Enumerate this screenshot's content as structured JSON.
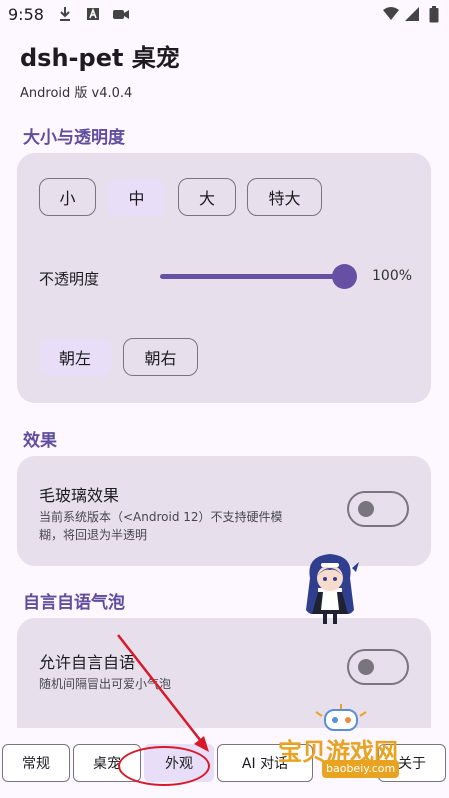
{
  "status_bar": {
    "time": "9:58",
    "icons": [
      "download-icon",
      "a-icon",
      "camera-icon",
      "wifi-icon",
      "signal-icon",
      "battery-icon"
    ]
  },
  "app": {
    "title": "dsh-pet 桌宠",
    "version": "Android 版 v4.0.4"
  },
  "size_section": {
    "title": "大小与透明度",
    "size_options": [
      "小",
      "中",
      "大",
      "特大"
    ],
    "selected_size": "中",
    "opacity_label": "不透明度",
    "opacity_value": "100%",
    "opacity_fraction": 1.0,
    "direction_options": [
      "朝左",
      "朝右"
    ],
    "selected_direction": "朝左"
  },
  "effects_section": {
    "title": "效果",
    "blur_title": "毛玻璃效果",
    "blur_desc_line1": "当前系统版本（<Android 12）不支持硬件模",
    "blur_desc_line2": "糊，将回退为半透明",
    "blur_enabled": false
  },
  "chatter_section": {
    "title": "自言自语气泡",
    "allow_title": "允许自言自语",
    "allow_desc": "随机间隔冒出可爱小气泡",
    "allow_enabled": false
  },
  "bottom_tabs": [
    "常规",
    "桌宠",
    "外观",
    "AI 对话",
    "关于"
  ],
  "selected_tab": "外观",
  "watermark": {
    "title": "宝贝游戏网",
    "url": "baobeiy.com"
  },
  "colors": {
    "accent": "#6750a4",
    "card": "#e7e0ec",
    "selected_chip": "#e8def8",
    "annotation_red": "#d7192a",
    "watermark_orange": "#e8a321"
  }
}
